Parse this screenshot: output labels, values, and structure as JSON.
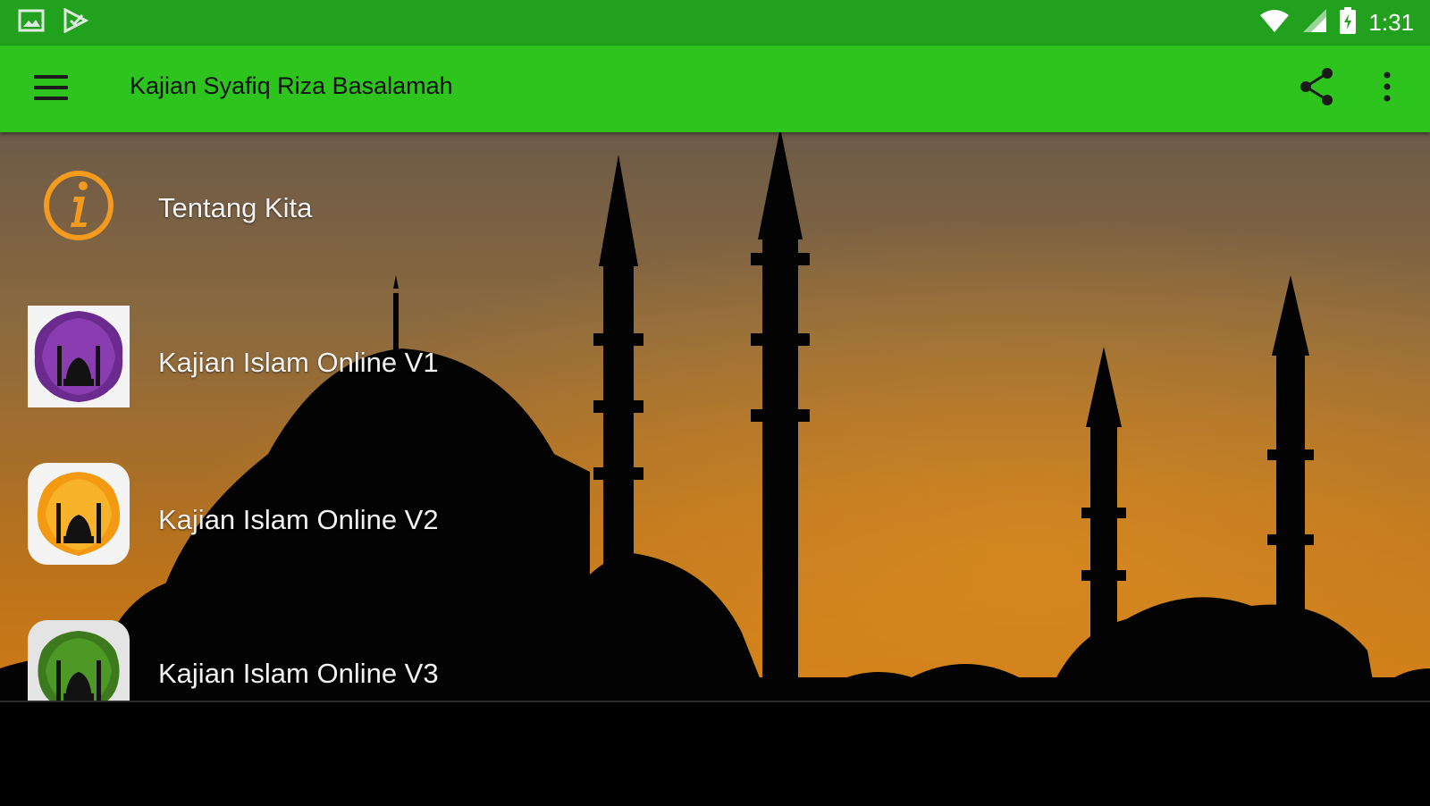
{
  "status_bar": {
    "time": "1:31",
    "left_icons": [
      "image-icon",
      "play-store-check-icon"
    ],
    "right_icons": [
      "wifi-icon",
      "signal-icon",
      "battery-icon"
    ]
  },
  "app_bar": {
    "title": "Kajian Syafiq Riza Basalamah",
    "icons": [
      "hamburger-menu-icon",
      "share-icon",
      "overflow-menu-icon"
    ],
    "color": "#2dc41d"
  },
  "menu_items": [
    {
      "label": "Tentang Kita",
      "icon": "info-icon"
    },
    {
      "label": "Kajian Islam Online V1",
      "icon": "purple-mosque-icon"
    },
    {
      "label": "Kajian Islam Online V2",
      "icon": "orange-mosque-icon"
    },
    {
      "label": "Kajian Islam Online V3",
      "icon": "green-mosque-icon"
    }
  ],
  "colors": {
    "status_bar": "#21a11e",
    "app_bar": "#2dc41d",
    "info_icon": "#f39a1f"
  }
}
